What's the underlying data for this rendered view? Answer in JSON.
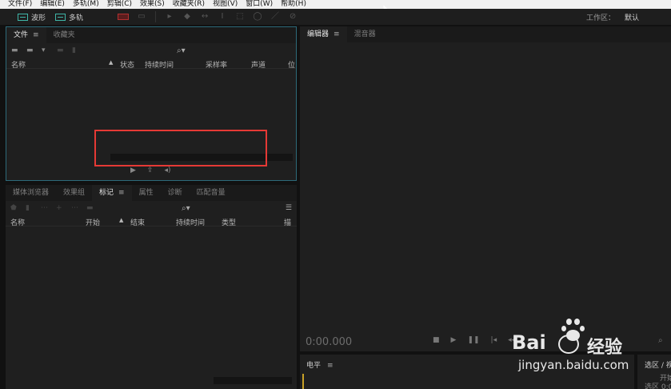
{
  "menu": [
    "文件(F)",
    "编辑(E)",
    "多轨(M)",
    "剪辑(C)",
    "效果(S)",
    "收藏夹(R)",
    "视图(V)",
    "窗口(W)",
    "帮助(H)"
  ],
  "toolbar": {
    "waveform_label": "波形",
    "multitrack_label": "多轨"
  },
  "workspace": {
    "label": "工作区：",
    "value": "默认"
  },
  "files_panel": {
    "tabs": [
      {
        "label": "文件",
        "menu": "≡"
      },
      {
        "label": "收藏夹"
      }
    ],
    "columns": [
      "名称",
      "▲",
      "状态",
      "持续时间",
      "采样率",
      "声道",
      "位"
    ]
  },
  "markers_panel": {
    "tabs": [
      "媒体浏览器",
      "效果组",
      "标记",
      "属性",
      "诊断",
      "匹配音量"
    ],
    "active_tab_menu": "≡",
    "columns": [
      "名称",
      "开始",
      "▲",
      "结束",
      "持续时间",
      "类型",
      "描"
    ]
  },
  "editor_panel": {
    "tabs": [
      {
        "label": "编辑器",
        "menu": "≡"
      },
      {
        "label": "混音器"
      }
    ],
    "time": "0:00.000"
  },
  "level_panel": {
    "label": "电平",
    "menu": "≡"
  },
  "selection_panel": {
    "label": "选区 / 视",
    "start": "开始",
    "row": "选区  0:0"
  },
  "watermark": {
    "brand": "Bai",
    "cn": "经验",
    "url": "jingyan.baidu.com"
  },
  "colors": {
    "accent": "#3fb6a8",
    "highlight": "#e53935"
  }
}
